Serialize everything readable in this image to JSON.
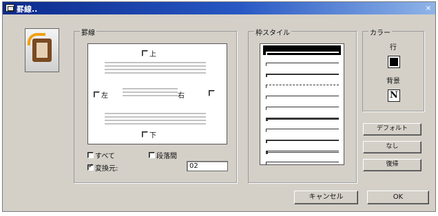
{
  "window": {
    "title": "罫線..",
    "close_glyph": "×"
  },
  "border_group": {
    "label": "罫線",
    "top": "上",
    "bottom": "下",
    "left": "左",
    "right": "右",
    "all": "すべて",
    "paragraph": "段落間",
    "replace": "変換元:",
    "replace_checked": true,
    "replace_value": "02"
  },
  "style_group": {
    "label": "枠スタイル",
    "styles": [
      "thick-white",
      "thin",
      "medium",
      "dotted",
      "thin",
      "thin",
      "thick",
      "thin",
      "medium",
      "double",
      "thin"
    ],
    "selected_index": 0
  },
  "color_group": {
    "label": "カラー",
    "line_label": "行",
    "bg_label": "背景",
    "bg_glyph": "N"
  },
  "buttons": {
    "default": "デフォルト",
    "none": "なし",
    "restore": "復帰",
    "cancel": "キャンセル",
    "ok": "OK"
  },
  "colors": {
    "title_bar": "#0b2a8c",
    "dialog_bg": "#d4d0c8",
    "frame_brown": "#7a4a22",
    "arrow_orange": "#f2a010"
  }
}
